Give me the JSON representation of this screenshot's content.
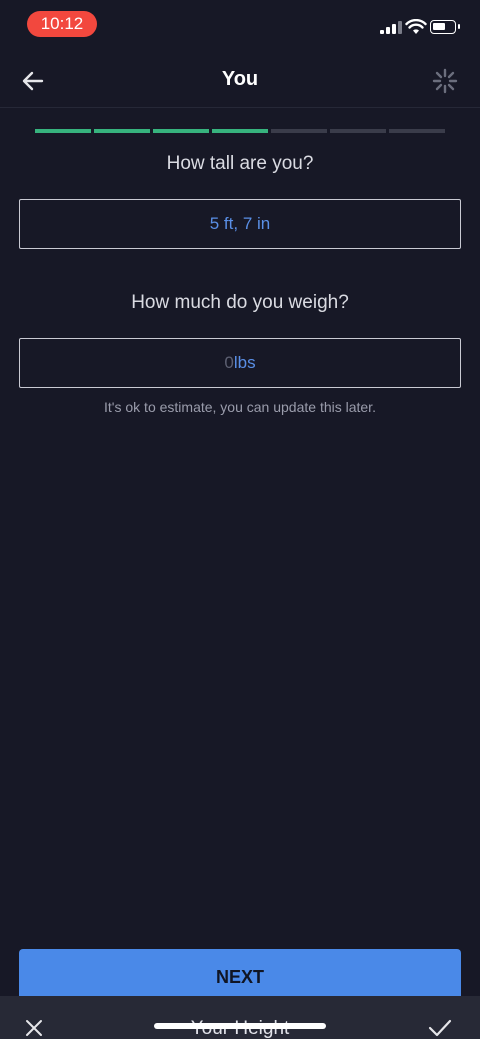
{
  "status_bar": {
    "time": "10:12"
  },
  "header": {
    "title": "You",
    "back_icon": "arrow-left-icon",
    "loading_icon": "spinner-icon"
  },
  "progress": {
    "total_steps": 7,
    "completed_steps": 4,
    "done_color": "#37b37e",
    "todo_color": "#3a3c4a"
  },
  "height": {
    "question": "How tall are you?",
    "value": "5 ft, 7 in"
  },
  "weight": {
    "question": "How much do you weigh?",
    "value": "0",
    "unit": "lbs",
    "hint": "It's ok to estimate, you can update this later."
  },
  "next_label": "NEXT",
  "bottom_sheet": {
    "title": "Your Height",
    "close_icon": "close-icon",
    "confirm_icon": "checkmark-icon"
  },
  "colors": {
    "background": "#171826",
    "accent": "#4a89e8",
    "value_text": "#5a8fe6"
  }
}
